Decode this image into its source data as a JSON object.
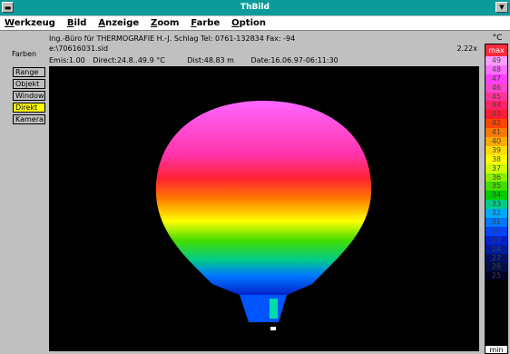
{
  "window": {
    "title": "ThBild",
    "system_icon": "dash-icon",
    "minimize_icon": "triangle-down-icon"
  },
  "menu": [
    "Werkzeug",
    "Bild",
    "Anzeige",
    "Zoom",
    "Farbe",
    "Option"
  ],
  "header": {
    "company_line": "Ing.-Büro für  THERMOGRAFIE  H.-J. Schlag  Tel: 0761-132834  Fax: -94",
    "file": "e:\\70616031.sid",
    "zoom": "2.22x",
    "emis": "Emis:1.00",
    "direct": "Direct:24.8..49.9 °C",
    "dist": "Dist:48.83 m",
    "date": "Date:16.06.97-06:11:30"
  },
  "left": {
    "farben_label": "Farben",
    "buttons": [
      "Range",
      "Objekt",
      "Window",
      "Direkt",
      "Kamera"
    ],
    "active_button": "Direkt"
  },
  "scale": {
    "unit": "°C",
    "max_label": "max",
    "min_label": "min",
    "levels": [
      "49",
      "48",
      "47",
      "46",
      "45",
      "44",
      "43",
      "42",
      "41",
      "40",
      "39",
      "38",
      "37",
      "36",
      "35",
      "34",
      "33",
      "32",
      "31",
      "30",
      "29",
      "28",
      "27",
      "26",
      "25"
    ],
    "colors": [
      "#ff9cff",
      "#ff6cff",
      "#ff3dff",
      "#ff44cc",
      "#ff3399",
      "#ff2266",
      "#ff1c33",
      "#ff4400",
      "#ff7700",
      "#ffaa00",
      "#ffdd00",
      "#ffff00",
      "#ccff00",
      "#88ee00",
      "#44dd00",
      "#00cc00",
      "#00cc88",
      "#00aaff",
      "#0077ff",
      "#0044ff",
      "#0022cc",
      "#001a99",
      "#001166",
      "#000f44",
      "#000022"
    ]
  }
}
